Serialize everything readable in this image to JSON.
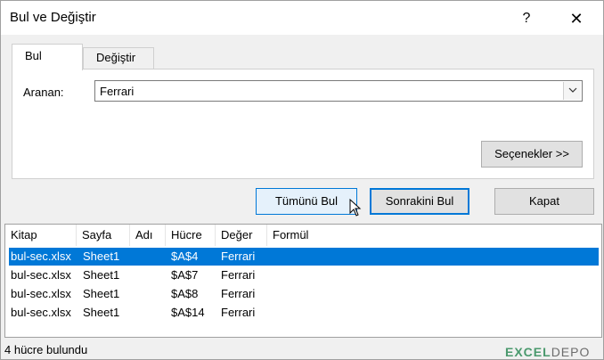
{
  "window": {
    "title": "Bul ve Değiştir",
    "help_glyph": "?",
    "close_glyph": "✕"
  },
  "tabs": [
    {
      "label": "Bul",
      "active": true
    },
    {
      "label": "Değiştir",
      "active": false
    }
  ],
  "find": {
    "label": "Aranan:",
    "value": "Ferrari"
  },
  "buttons": {
    "options": "Seçenekler >>",
    "find_all": "Tümünü Bul",
    "find_next": "Sonrakini Bul",
    "close": "Kapat"
  },
  "results": {
    "columns": [
      "Kitap",
      "Sayfa",
      "Adı",
      "Hücre",
      "Değer",
      "Formül"
    ],
    "rows": [
      {
        "kitap": "bul-sec.xlsx",
        "sayfa": "Sheet1",
        "adi": "",
        "hucre": "$A$4",
        "deger": "Ferrari",
        "formul": "",
        "selected": true
      },
      {
        "kitap": "bul-sec.xlsx",
        "sayfa": "Sheet1",
        "adi": "",
        "hucre": "$A$7",
        "deger": "Ferrari",
        "formul": "",
        "selected": false
      },
      {
        "kitap": "bul-sec.xlsx",
        "sayfa": "Sheet1",
        "adi": "",
        "hucre": "$A$8",
        "deger": "Ferrari",
        "formul": "",
        "selected": false
      },
      {
        "kitap": "bul-sec.xlsx",
        "sayfa": "Sheet1",
        "adi": "",
        "hucre": "$A$14",
        "deger": "Ferrari",
        "formul": "",
        "selected": false
      }
    ]
  },
  "status": {
    "text": "4 hücre bulundu"
  },
  "watermark": {
    "part1": "EXCEL",
    "part2": "DEPO"
  },
  "colors": {
    "accent": "#0078d7",
    "selection": "#0078d7"
  }
}
